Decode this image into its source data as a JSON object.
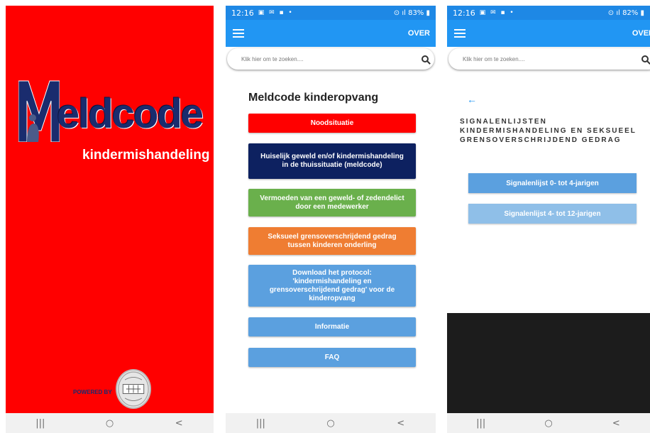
{
  "splash": {
    "logo_initial": "M",
    "logo_rest": "eldcode",
    "subtitle": "kindermishandeling",
    "powered_by": "POWERED BY"
  },
  "status_bar_2": {
    "time": "12:16",
    "battery": "83%"
  },
  "status_bar_3": {
    "time": "12:16",
    "battery": "82%"
  },
  "appbar": {
    "menu_icon": "hamburger-icon",
    "over_label": "OVER"
  },
  "search": {
    "placeholder": "Klik hier om te zoeken....",
    "icon": "search-icon"
  },
  "home": {
    "title": "Meldcode kinderopvang",
    "buttons": [
      {
        "label": "Noodsituatie",
        "color": "#ff0000"
      },
      {
        "label": "Huiselijk geweld en/of kindermishandeling in de thuissituatie (meldcode)",
        "color": "#0d2160"
      },
      {
        "label": "Vermoeden van een geweld- of zedendelict door een medewerker",
        "color": "#6ab04c"
      },
      {
        "label": "Seksueel grensoverschrijdend gedrag tussen kinderen onderling",
        "color": "#ef7d32"
      },
      {
        "label": "Download het protocol: 'kindermishandeling en grensoverschrijdend gedrag' voor de kinderopvang",
        "color": "#5ba0df"
      },
      {
        "label": "Informatie",
        "color": "#5ba0df"
      },
      {
        "label": "FAQ",
        "color": "#5ba0df"
      }
    ]
  },
  "signalen": {
    "back_icon": "arrow-left-icon",
    "title": "SIGNALENLIJSTEN KINDERMISHANDELING EN SEKSUEEL GRENSOVERSCHRIJDEND GEDRAG",
    "buttons": [
      {
        "label": "Signalenlijst 0- tot 4-jarigen",
        "color": "#5ba0df"
      },
      {
        "label": "Signalenlijst 4- tot 12-jarigen",
        "color": "#8fbfe8"
      }
    ]
  },
  "navbar": {
    "recent": "|||",
    "home": "○",
    "back": "<"
  }
}
